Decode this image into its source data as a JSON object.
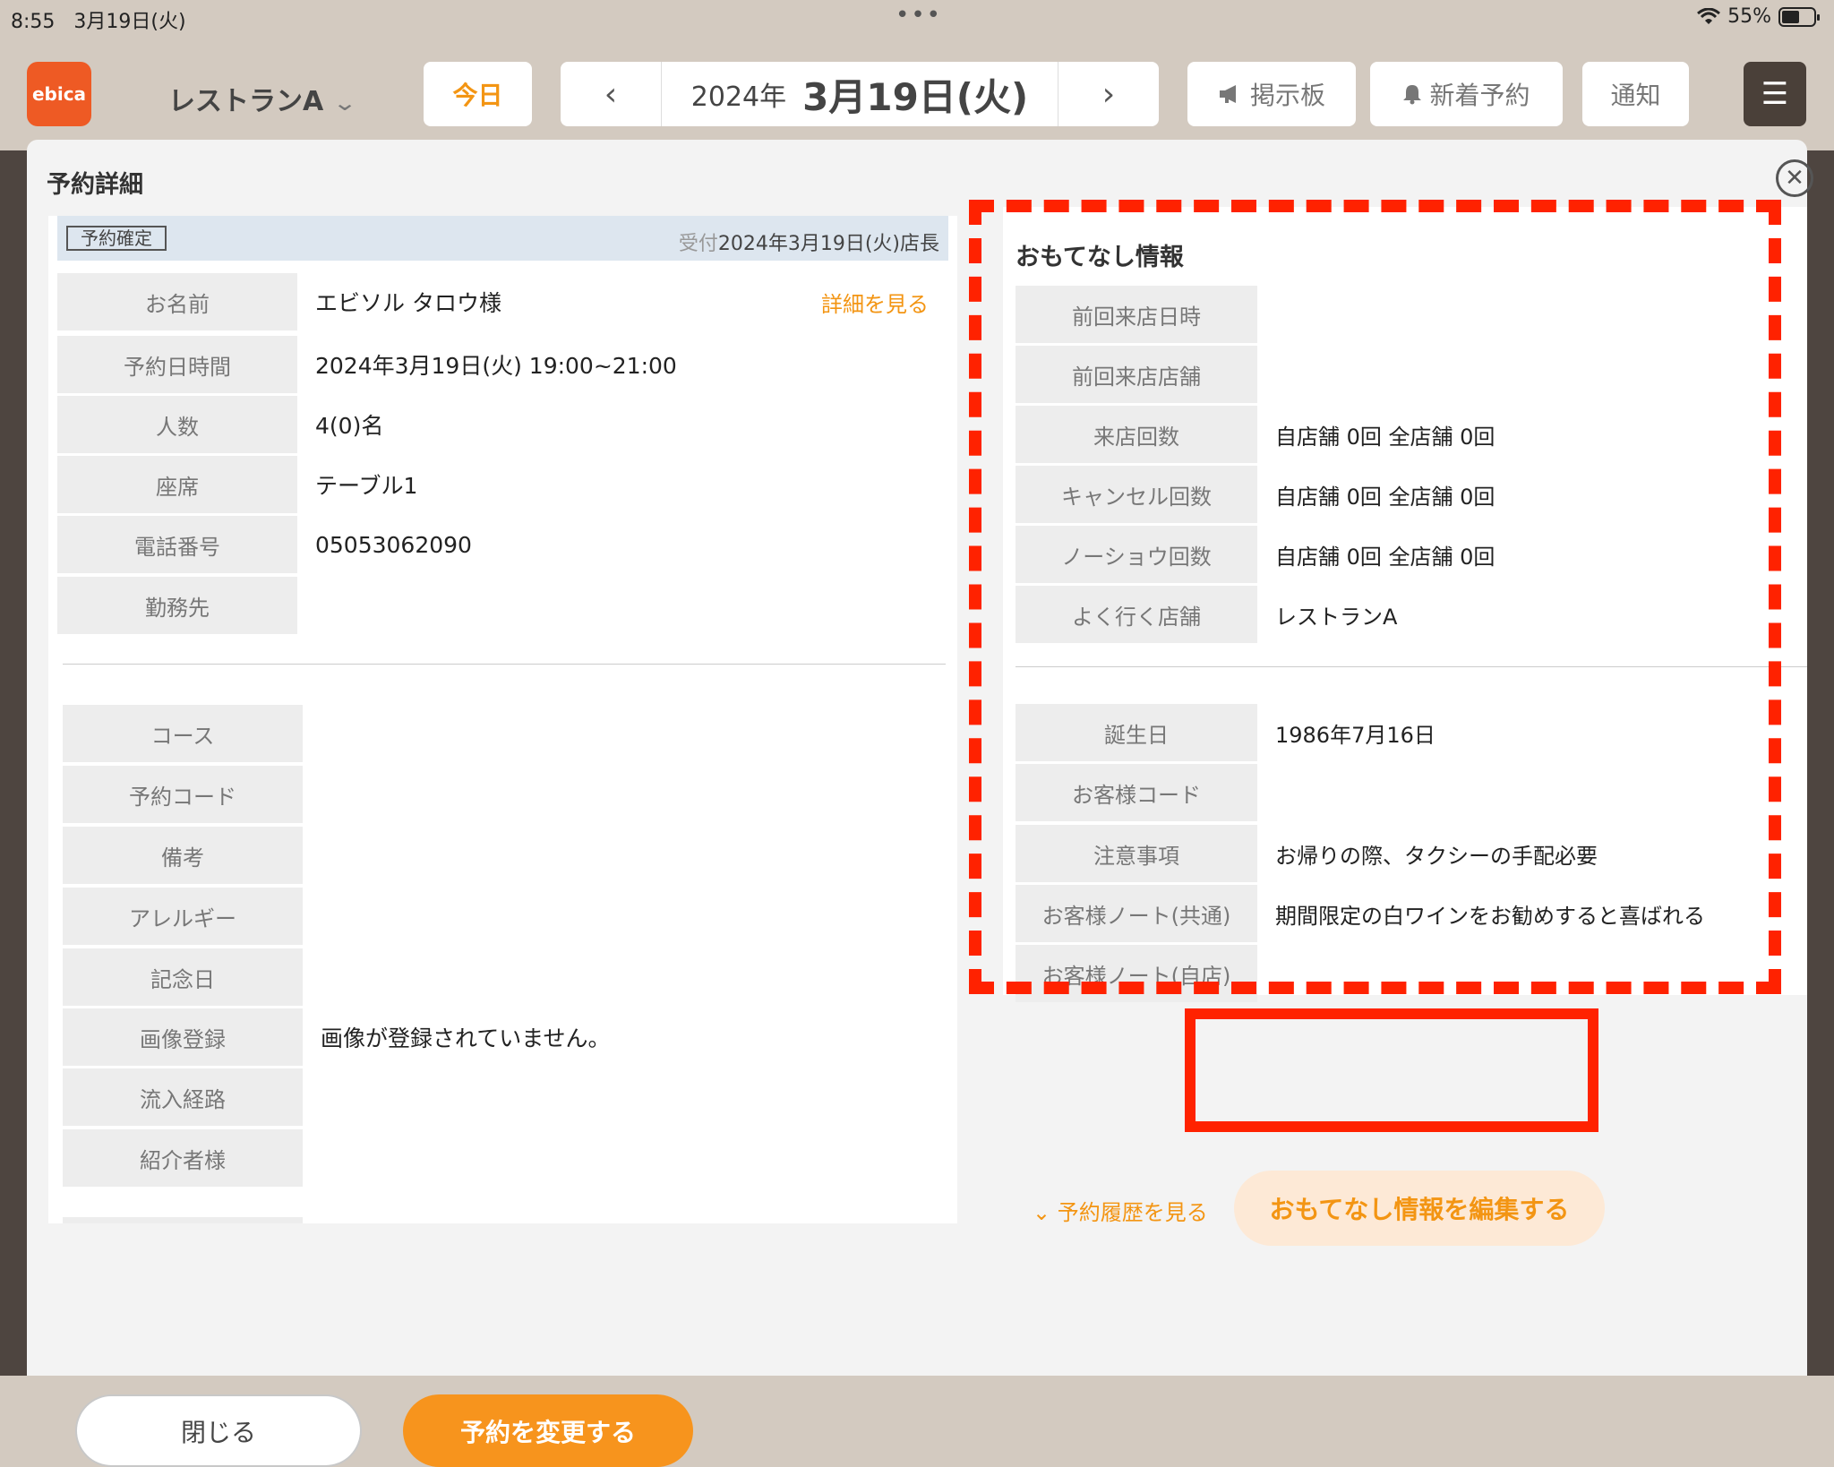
{
  "status_bar": {
    "time": "8:55",
    "date": "3月19日(火)",
    "dots": "•••",
    "battery": "55%",
    "battery_level": 0.55
  },
  "header": {
    "logo": "ebica",
    "store": "レストランA",
    "today": "今日",
    "date": {
      "year": "2024年",
      "main": "3月19日(火)"
    },
    "prev_icon": "chevron-left-icon",
    "next_icon": "chevron-right-icon",
    "notice_board": "掲示板",
    "new_reservations": "新着予約",
    "notifications": "通知"
  },
  "modal": {
    "title": "予約詳細",
    "status_badge": "予約確定",
    "received_label": "受付",
    "received_value": "2024年3月19日(火)店長",
    "detail_link": "詳細を見る",
    "rows": [
      {
        "label": "お名前",
        "value": "エビソル タロウ様"
      },
      {
        "label": "予約日時間",
        "value": "2024年3月19日(火) 19:00~21:00"
      },
      {
        "label": "人数",
        "value": "4(0)名"
      },
      {
        "label": "座席",
        "value": "テーブル1"
      },
      {
        "label": "電話番号",
        "value": "05053062090"
      },
      {
        "label": "勤務先",
        "value": ""
      }
    ],
    "rows2": [
      {
        "label": "コース",
        "value": ""
      },
      {
        "label": "予約コード",
        "value": ""
      },
      {
        "label": "備考",
        "value": ""
      },
      {
        "label": "アレルギー",
        "value": ""
      },
      {
        "label": "記念日",
        "value": ""
      },
      {
        "label": "画像登録",
        "value": "画像が登録されていません。"
      },
      {
        "label": "流入経路",
        "value": ""
      },
      {
        "label": "紹介者様",
        "value": ""
      }
    ],
    "omotenashi": {
      "title": "おもてなし情報",
      "rows": [
        {
          "label": "前回来店日時",
          "value": ""
        },
        {
          "label": "前回来店店舗",
          "value": ""
        },
        {
          "label": "来店回数",
          "value": "自店舗 0回 全店舗 0回"
        },
        {
          "label": "キャンセル回数",
          "value": "自店舗 0回 全店舗 0回"
        },
        {
          "label": "ノーショウ回数",
          "value": "自店舗 0回 全店舗 0回"
        },
        {
          "label": "よく行く店舗",
          "value": "レストランA"
        }
      ],
      "rows2": [
        {
          "label": "誕生日",
          "value": "1986年7月16日"
        },
        {
          "label": "お客様コード",
          "value": ""
        },
        {
          "label": "注意事項",
          "value": "お帰りの際、タクシーの手配必要"
        },
        {
          "label": "お客様ノート(共通)",
          "value": "期間限定の白ワインをお勧めすると喜ばれる"
        },
        {
          "label": "お客様ノート(自店)",
          "value": ""
        }
      ]
    },
    "history_link": "予約履歴を見る",
    "edit_button": "おもてなし情報を編集する",
    "close_button": "閉じる",
    "change_button": "予約を変更する"
  }
}
